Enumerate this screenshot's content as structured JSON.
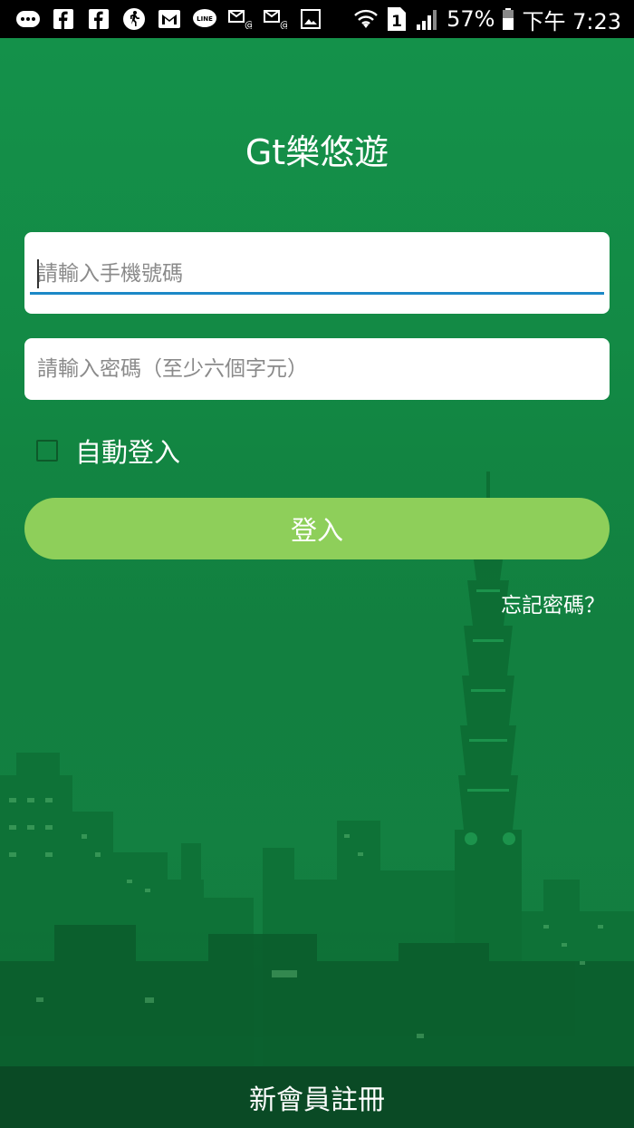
{
  "status_bar": {
    "icons": [
      "more-icon",
      "facebook-icon",
      "facebook-icon",
      "runner-icon",
      "gmail-icon",
      "line-icon",
      "mail-at-icon",
      "mail-at-icon",
      "image-icon",
      "wifi-icon",
      "sim-icon",
      "signal-icon",
      "battery-icon"
    ],
    "sim_label": "1",
    "battery_percent": "57%",
    "time": "下午 7:23"
  },
  "app": {
    "title": "Gt樂悠遊"
  },
  "form": {
    "phone_placeholder": "請輸入手機號碼",
    "phone_value": "",
    "password_placeholder": "請輸入密碼（至少六個字元）",
    "password_value": "",
    "auto_login_label": "自動登入",
    "auto_login_checked": false,
    "login_label": "登入",
    "forgot_label": "忘記密碼？"
  },
  "footer": {
    "register_label": "新會員註冊"
  },
  "colors": {
    "background": "#138a45",
    "button": "#8ecf5a",
    "focus_underline": "#1c88c7",
    "register_bar": "#0a4623"
  }
}
